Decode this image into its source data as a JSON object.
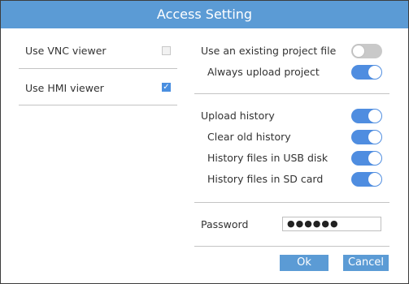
{
  "title": "Access Setting",
  "left": {
    "vnc": {
      "label": "Use VNC viewer",
      "checked": false
    },
    "hmi": {
      "label": "Use HMI viewer",
      "checked": true
    }
  },
  "right": {
    "existing_project": {
      "label": "Use an existing project file",
      "on": false
    },
    "always_upload": {
      "label": "Always upload project",
      "on": true
    },
    "upload_history": {
      "label": "Upload history",
      "on": true
    },
    "clear_old_history": {
      "label": "Clear old history",
      "on": true
    },
    "history_usb": {
      "label": "History files in USB disk",
      "on": true
    },
    "history_sd": {
      "label": "History files in SD card",
      "on": true
    },
    "password": {
      "label": "Password",
      "value": "●●●●●●"
    }
  },
  "buttons": {
    "ok": "Ok",
    "cancel": "Cancel"
  },
  "colors": {
    "accent": "#5b9bd5",
    "toggle_on": "#4f8de0",
    "toggle_off": "#c9c9c9"
  },
  "icons": {
    "checkmark": "check-icon"
  }
}
